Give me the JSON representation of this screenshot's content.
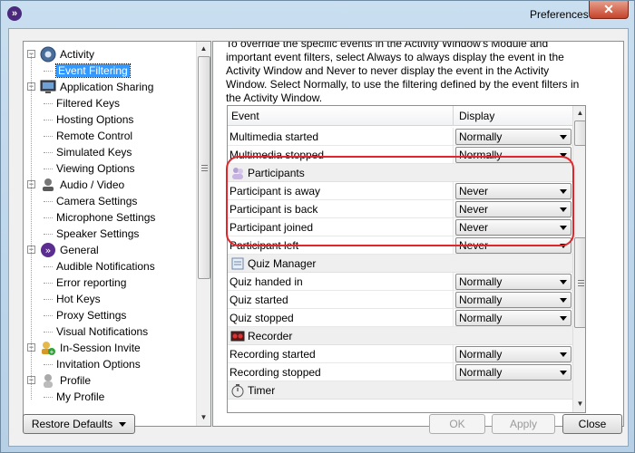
{
  "window": {
    "title": "Preferences",
    "close_glyph": "✕"
  },
  "tree": [
    {
      "label": "Activity",
      "kind": "cat",
      "icon": "activity-icon",
      "expanded": true
    },
    {
      "label": "Event Filtering",
      "kind": "child",
      "selected": true
    },
    {
      "label": "Application Sharing",
      "kind": "cat",
      "icon": "monitor-icon",
      "expanded": true
    },
    {
      "label": "Filtered Keys",
      "kind": "child"
    },
    {
      "label": "Hosting Options",
      "kind": "child"
    },
    {
      "label": "Remote Control",
      "kind": "child"
    },
    {
      "label": "Simulated Keys",
      "kind": "child"
    },
    {
      "label": "Viewing Options",
      "kind": "child"
    },
    {
      "label": "Audio / Video",
      "kind": "cat",
      "icon": "audio-video-icon",
      "expanded": true
    },
    {
      "label": "Camera Settings",
      "kind": "child"
    },
    {
      "label": "Microphone Settings",
      "kind": "child"
    },
    {
      "label": "Speaker Settings",
      "kind": "child"
    },
    {
      "label": "General",
      "kind": "cat",
      "icon": "general-icon",
      "expanded": true
    },
    {
      "label": "Audible Notifications",
      "kind": "child"
    },
    {
      "label": "Error reporting",
      "kind": "child"
    },
    {
      "label": "Hot Keys",
      "kind": "child"
    },
    {
      "label": "Proxy Settings",
      "kind": "child"
    },
    {
      "label": "Visual Notifications",
      "kind": "child"
    },
    {
      "label": "In-Session Invite",
      "kind": "cat",
      "icon": "invite-icon",
      "expanded": true
    },
    {
      "label": "Invitation Options",
      "kind": "child"
    },
    {
      "label": "Profile",
      "kind": "cat",
      "icon": "profile-icon",
      "expanded": true
    },
    {
      "label": "My Profile",
      "kind": "child"
    }
  ],
  "description": "To override the specific events in the Activity Window's Module and important event filters, select Always to always display the event in the Activity Window and Never to never display the event in the Activity Window. Select Normally, to use the filtering defined by the event filters in the Activity Window.",
  "table": {
    "col_event": "Event",
    "col_display": "Display",
    "rows": [
      {
        "type": "row",
        "event": "Multimedia started",
        "display": "Normally"
      },
      {
        "type": "row",
        "event": "Multimedia stopped",
        "display": "Normally"
      },
      {
        "type": "group",
        "label": "Participants",
        "icon": "participants-icon"
      },
      {
        "type": "row",
        "event": "Participant is away",
        "display": "Never"
      },
      {
        "type": "row",
        "event": "Participant is back",
        "display": "Never"
      },
      {
        "type": "row",
        "event": "Participant joined",
        "display": "Never"
      },
      {
        "type": "row",
        "event": "Participant left",
        "display": "Never"
      },
      {
        "type": "group",
        "label": "Quiz Manager",
        "icon": "quiz-manager-icon"
      },
      {
        "type": "row",
        "event": "Quiz handed in",
        "display": "Normally"
      },
      {
        "type": "row",
        "event": "Quiz started",
        "display": "Normally"
      },
      {
        "type": "row",
        "event": "Quiz stopped",
        "display": "Normally"
      },
      {
        "type": "group",
        "label": "Recorder",
        "icon": "recorder-icon"
      },
      {
        "type": "row",
        "event": "Recording started",
        "display": "Normally"
      },
      {
        "type": "row",
        "event": "Recording stopped",
        "display": "Normally"
      },
      {
        "type": "group",
        "label": "Timer",
        "icon": "timer-icon"
      }
    ]
  },
  "buttons": {
    "restore": "Restore Defaults",
    "ok": "OK",
    "apply": "Apply",
    "close": "Close"
  },
  "colors": {
    "accent": "#3399ff",
    "highlight_ring": "#e0262b",
    "brand": "#4b2a7e"
  }
}
